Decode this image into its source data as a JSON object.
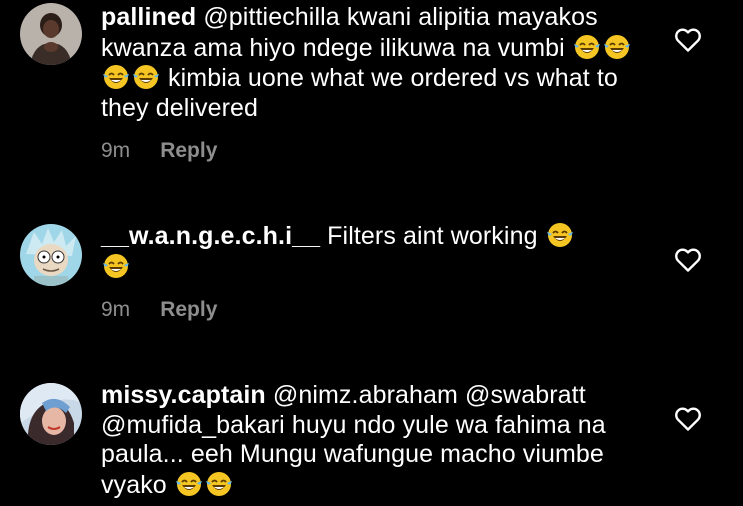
{
  "comments": [
    {
      "username": "pallined",
      "segments": [
        "@pittiechilla  kwani alipitia mayakos kwanza ama hiyo ndege ilikuwa na vumbi ",
        " kimbia uone what we ordered vs what to they delivered"
      ],
      "emoji_count": 4,
      "emoji_icon": "face-with-tears-of-joy-icon",
      "time": "9m",
      "reply_label": "Reply"
    },
    {
      "username": "__w.a.n.g.e.c.h.i__",
      "segments": [
        "Filters aint working "
      ],
      "emoji_count": 2,
      "emoji_icon": "face-with-tears-of-joy-icon",
      "time": "9m",
      "reply_label": "Reply"
    },
    {
      "username": "missy.captain",
      "segments": [
        "@nimz.abraham @swabratt @mufida_bakari huyu ndo yule wa fahima na paula... eeh Mungu wafungue macho viumbe vyako "
      ],
      "emoji_count": 2,
      "emoji_icon": "face-with-tears-of-joy-icon",
      "time": "",
      "reply_label": ""
    }
  ],
  "colors": {
    "background": "#000000",
    "text": "#ffffff",
    "meta": "#8e8e8e"
  }
}
